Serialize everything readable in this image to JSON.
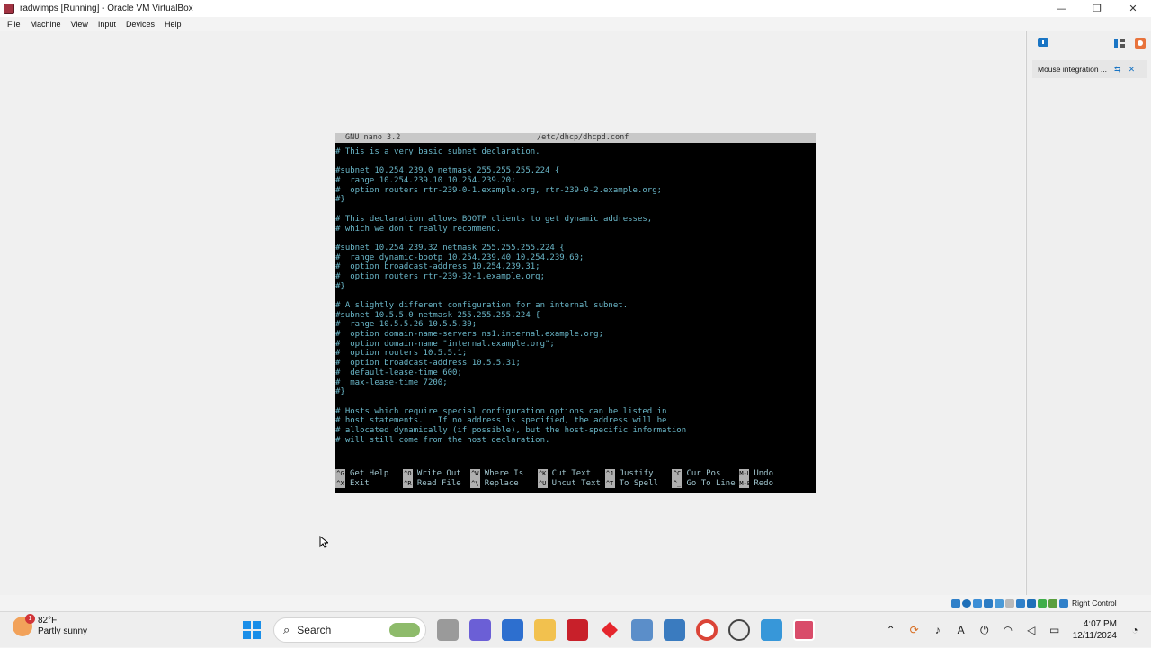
{
  "window": {
    "title": "radwimps [Running] - Oracle VM VirtualBox",
    "minimize": "—",
    "restore": "❐",
    "close": "✕"
  },
  "menu": [
    "File",
    "Machine",
    "View",
    "Input",
    "Devices",
    "Help"
  ],
  "nano": {
    "version": "GNU nano 3.2",
    "filename": "/etc/dhcp/dhcpd.conf",
    "lines": [
      "# This is a very basic subnet declaration.",
      "",
      "#subnet 10.254.239.0 netmask 255.255.255.224 {",
      "#  range 10.254.239.10 10.254.239.20;",
      "#  option routers rtr-239-0-1.example.org, rtr-239-0-2.example.org;",
      "#}",
      "",
      "# This declaration allows BOOTP clients to get dynamic addresses,",
      "# which we don't really recommend.",
      "",
      "#subnet 10.254.239.32 netmask 255.255.255.224 {",
      "#  range dynamic-bootp 10.254.239.40 10.254.239.60;",
      "#  option broadcast-address 10.254.239.31;",
      "#  option routers rtr-239-32-1.example.org;",
      "#}",
      "",
      "# A slightly different configuration for an internal subnet.",
      "#subnet 10.5.5.0 netmask 255.255.255.224 {",
      "#  range 10.5.5.26 10.5.5.30;",
      "#  option domain-name-servers ns1.internal.example.org;",
      "#  option domain-name \"internal.example.org\";",
      "#  option routers 10.5.5.1;",
      "#  option broadcast-address 10.5.5.31;",
      "#  default-lease-time 600;",
      "#  max-lease-time 7200;",
      "#}",
      "",
      "# Hosts which require special configuration options can be listed in",
      "# host statements.   If no address is specified, the address will be",
      "# allocated dynamically (if possible), but the host-specific information",
      "# will still come from the host declaration."
    ],
    "shortcuts_row1": [
      {
        "key": "^G",
        "label": "Get Help"
      },
      {
        "key": "^O",
        "label": "Write Out"
      },
      {
        "key": "^W",
        "label": "Where Is"
      },
      {
        "key": "^K",
        "label": "Cut Text"
      },
      {
        "key": "^J",
        "label": "Justify"
      },
      {
        "key": "^C",
        "label": "Cur Pos"
      },
      {
        "key": "M-U",
        "label": "Undo"
      }
    ],
    "shortcuts_row2": [
      {
        "key": "^X",
        "label": "Exit"
      },
      {
        "key": "^R",
        "label": "Read File"
      },
      {
        "key": "^\\",
        "label": "Replace"
      },
      {
        "key": "^U",
        "label": "Uncut Text"
      },
      {
        "key": "^T",
        "label": "To Spell"
      },
      {
        "key": "^_",
        "label": "Go To Line"
      },
      {
        "key": "M-E",
        "label": "Redo"
      }
    ]
  },
  "side_panel": {
    "message": "Mouse integration ..."
  },
  "vm_status": {
    "host_key": "Right Control"
  },
  "taskbar": {
    "weather_temp": "82°F",
    "weather_desc": "Partly sunny",
    "weather_badge": "1",
    "search_label": "Search",
    "time": "4:07 PM",
    "date": "12/11/2024"
  },
  "colors": {
    "terminal_bg": "#000000",
    "terminal_text": "#6ab7c9",
    "nano_bar": "#c8c8c8"
  }
}
